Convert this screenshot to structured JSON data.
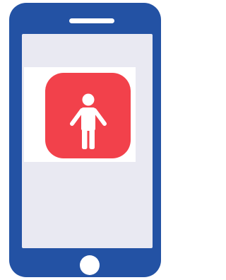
{
  "device": {
    "type": "smartphone",
    "frame_color": "#2352a4",
    "screen_color": "#e9e9f2"
  },
  "app_icon": {
    "icon": "person-icon",
    "background_color": "#f2414b",
    "glyph_color": "#ffffff"
  }
}
